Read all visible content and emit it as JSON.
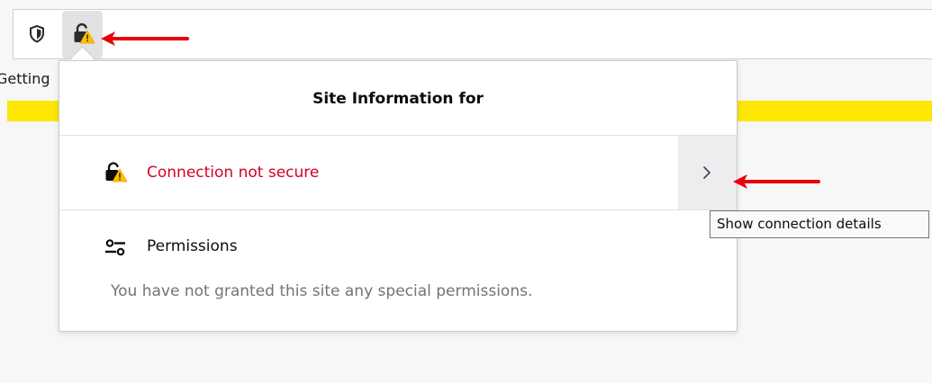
{
  "browser": {
    "bookmark_partial_text": "Getting"
  },
  "panel": {
    "title": "Site Information for",
    "connection_status": "Connection not secure",
    "connection_color": "#d70022",
    "permissions_title": "Permissions",
    "permissions_description": "You have not granted this site any special permissions."
  },
  "tooltip": {
    "text": "Show connection details"
  },
  "colors": {
    "highlight_bar": "#fde600",
    "annotation_arrow": "#e8000d"
  },
  "icons": {
    "tracking_protection": "shield-icon",
    "insecure_lock": "lock-warning-icon",
    "expand": "chevron-right-icon",
    "permissions": "permissions-sliders-icon"
  }
}
